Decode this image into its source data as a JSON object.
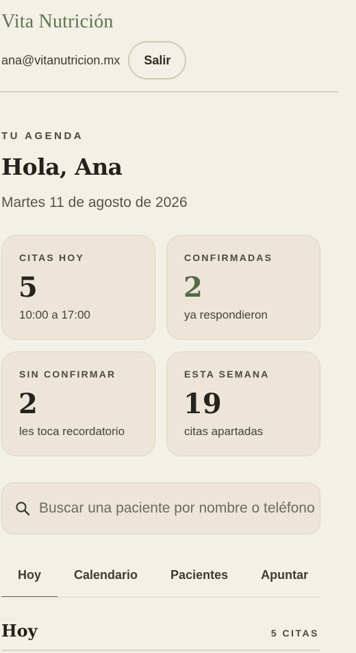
{
  "header": {
    "brand": "Vita Nutrición",
    "user_email": "ana@vitanutricion.mx",
    "logout_label": "Salir"
  },
  "agenda": {
    "eyebrow": "TU AGENDA",
    "greeting": "Hola, Ana",
    "date": "Martes 11 de agosto de 2026"
  },
  "stats": [
    {
      "label": "CITAS HOY",
      "value": "5",
      "sub": "10:00 a 17:00"
    },
    {
      "label": "CONFIRMADAS",
      "value": "2",
      "sub": "ya respondieron"
    },
    {
      "label": "SIN CONFIRMAR",
      "value": "2",
      "sub": "les toca recordatorio"
    },
    {
      "label": "ESTA SEMANA",
      "value": "19",
      "sub": "citas apartadas"
    }
  ],
  "search": {
    "placeholder": "Buscar una paciente por nombre o teléfono",
    "value": ""
  },
  "tabs": [
    {
      "label": "Hoy",
      "active": true
    },
    {
      "label": "Calendario",
      "active": false
    },
    {
      "label": "Pacientes",
      "active": false
    },
    {
      "label": "Apuntar",
      "active": false
    }
  ],
  "section": {
    "title": "Hoy",
    "count": "5 CITAS"
  },
  "colors": {
    "accent": "#5f7350",
    "background": "#f3f0e5",
    "card": "#ede6d8"
  }
}
